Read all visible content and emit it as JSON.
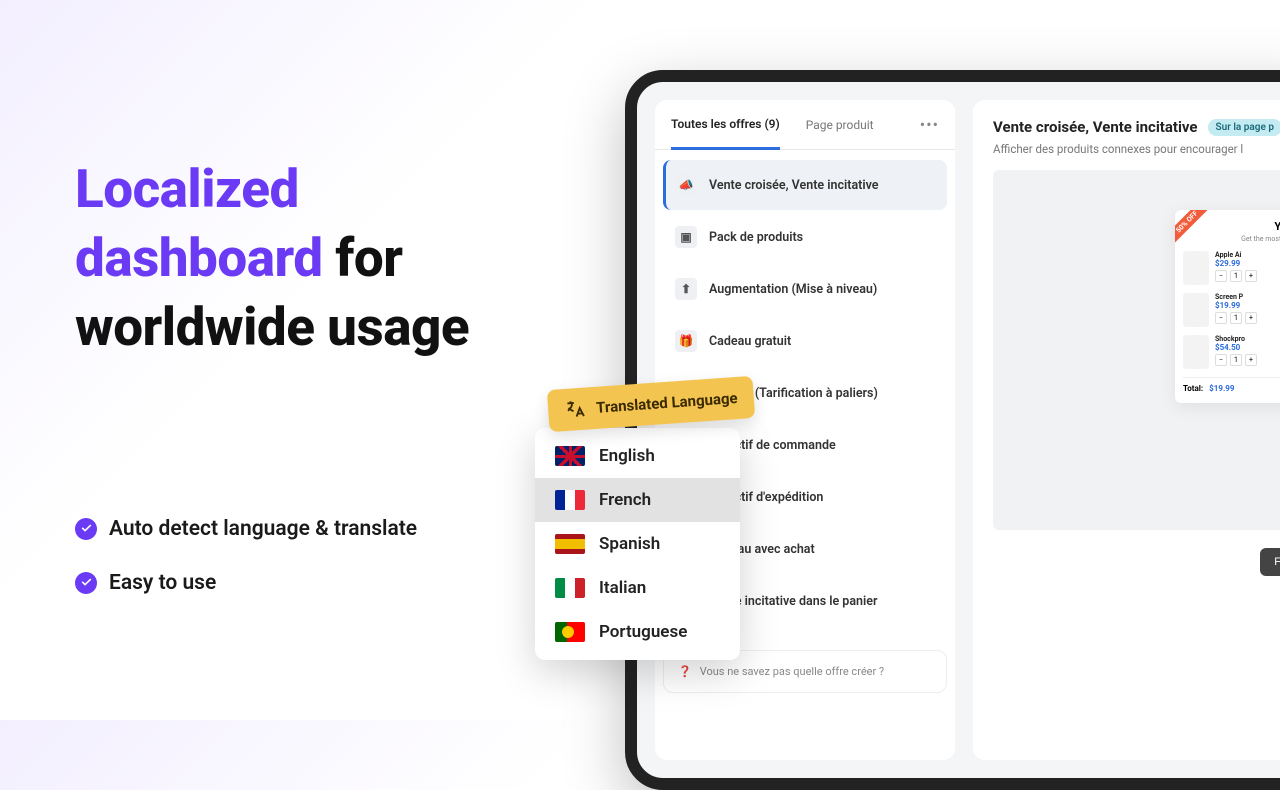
{
  "headline": {
    "accent": "Localized dashboard",
    "rest": " for worldwide usage"
  },
  "features": [
    "Auto detect language & translate",
    "Easy to use"
  ],
  "trans_tag": "Translated Language",
  "languages": [
    {
      "name": "English",
      "flag": "en"
    },
    {
      "name": "French",
      "flag": "fr",
      "selected": true
    },
    {
      "name": "Spanish",
      "flag": "es"
    },
    {
      "name": "Italian",
      "flag": "it"
    },
    {
      "name": "Portuguese",
      "flag": "pt"
    }
  ],
  "tabs": {
    "all": "Toutes les offres (9)",
    "product": "Page produit"
  },
  "offers": [
    "Vente croisée, Vente incitative",
    "Pack de produits",
    "Augmentation (Mise à niveau)",
    "Cadeau gratuit",
    "Volume (Tarification à paliers)",
    "Objectif de commande",
    "Objectif d'expédition",
    "Cadeau avec achat",
    "Vente incitative dans le panier"
  ],
  "hint": "Vous ne savez pas quelle offre créer ?",
  "right": {
    "title": "Vente croisée, Vente incitative",
    "badge": "Sur la page p",
    "subtitle": "Afficher des produits connexes pour encourager l",
    "ribbon": "50% OFF",
    "preview_title": "Yo",
    "preview_sub": "Get the most o",
    "items": [
      {
        "name": "Apple Ai",
        "price": "$29.99"
      },
      {
        "name": "Screen P",
        "price": "$19.99",
        "old": "$"
      },
      {
        "name": "Shockpro",
        "price": "$54.50",
        "old": "$"
      }
    ],
    "total_label": "Total:",
    "total_value": "$19.99"
  }
}
